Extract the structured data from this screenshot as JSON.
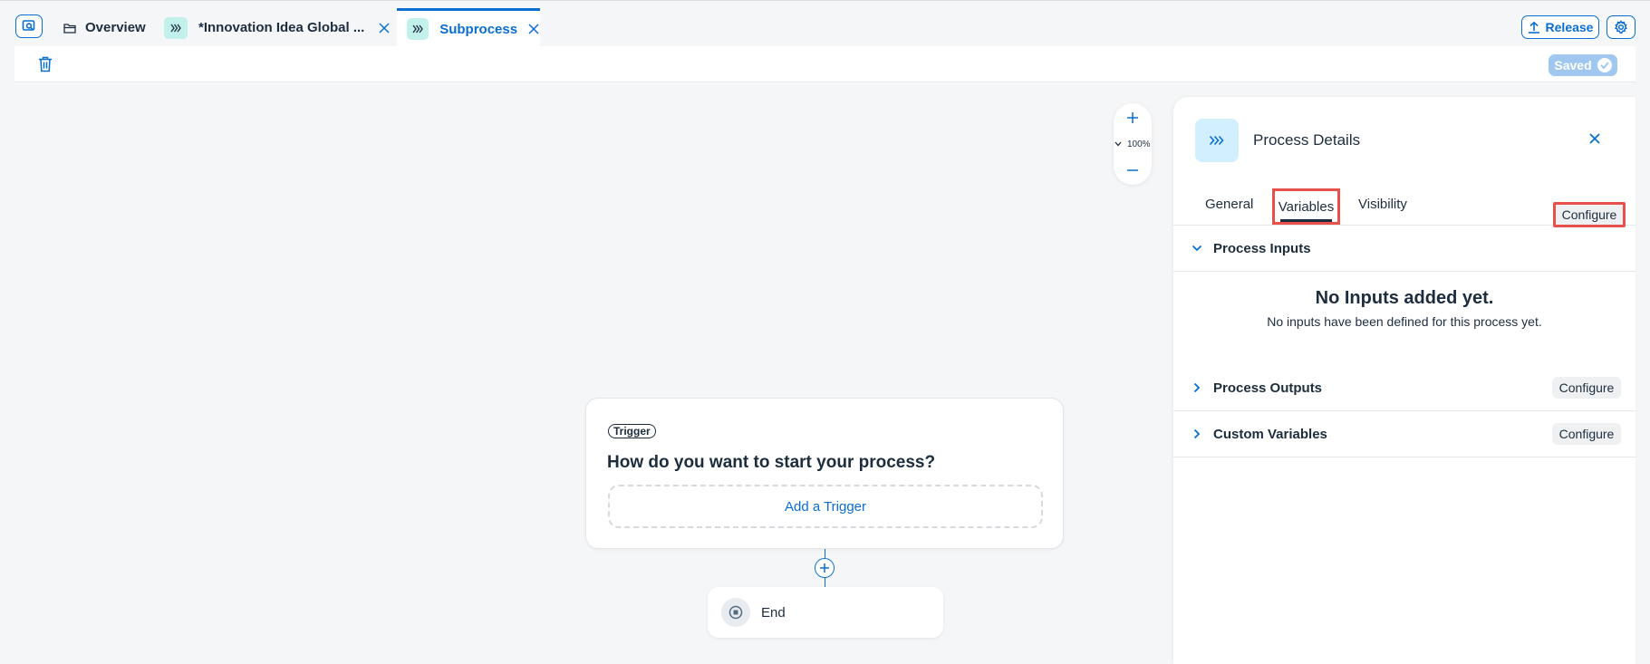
{
  "tabs": {
    "overview": "Overview",
    "innovation": "*Innovation Idea Global ...",
    "subprocess": "Subprocess"
  },
  "header": {
    "release_label": "Release"
  },
  "toolbar": {
    "saved_label": "Saved"
  },
  "zoom": {
    "level": "100%"
  },
  "canvas": {
    "trigger_badge": "Trigger",
    "trigger_question": "How do you want to start your process?",
    "add_trigger_label": "Add a Trigger",
    "end_label": "End"
  },
  "panel": {
    "title": "Process Details",
    "tabs": [
      "General",
      "Variables",
      "Visibility"
    ],
    "active_tab": "Variables",
    "sections": {
      "inputs": {
        "title": "Process Inputs",
        "configure": "Configure",
        "expanded": true
      },
      "outputs": {
        "title": "Process Outputs",
        "configure": "Configure",
        "expanded": false
      },
      "custom": {
        "title": "Custom Variables",
        "configure": "Configure",
        "expanded": false
      }
    },
    "empty_state": {
      "title": "No Inputs added yet.",
      "subtitle": "No inputs have been defined for this process yet."
    }
  },
  "colors": {
    "accent": "#0a6ed1",
    "highlight": "#e8514b",
    "chip": "#c2f0ea",
    "saved_bg": "#9fc7ef"
  },
  "icons": {
    "search": "search-icon",
    "folder": "folder-icon",
    "subprocess": "chevrons-right-icon",
    "close": "close-icon",
    "upload": "upload-icon",
    "settings": "gear-icon",
    "trash": "trash-icon",
    "check": "check-icon",
    "plus": "plus-icon",
    "minus": "minus-icon",
    "stop": "stop-icon"
  }
}
